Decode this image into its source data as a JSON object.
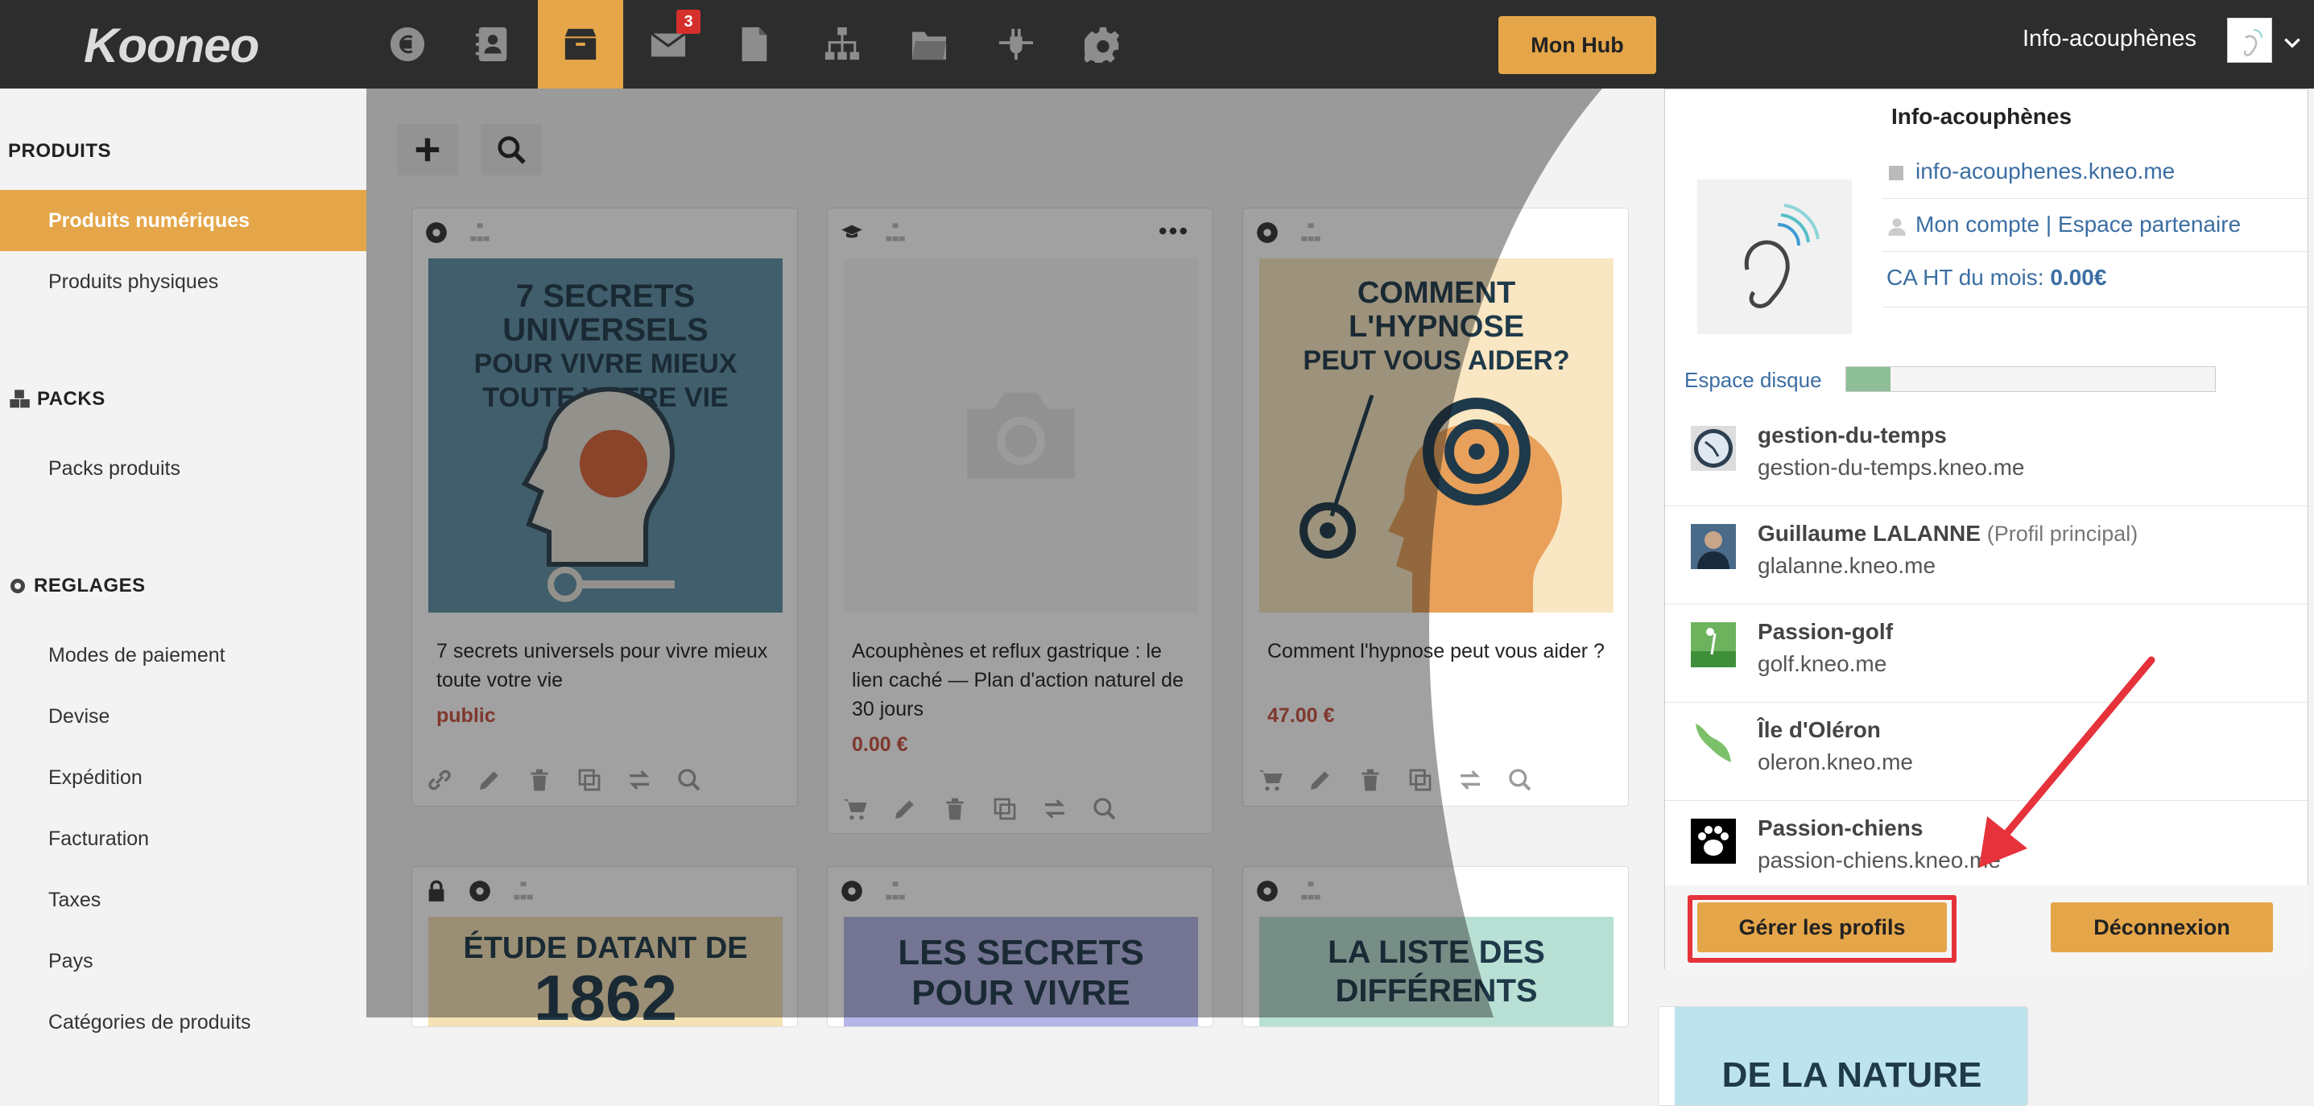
{
  "app": {
    "logo": "Kooneo",
    "username": "Info-acouphènes",
    "hub_label": "Mon Hub",
    "mail_count": "3"
  },
  "topnav": [
    {
      "icon": "euro-icon"
    },
    {
      "icon": "contacts-icon"
    },
    {
      "icon": "box-icon",
      "active": true
    },
    {
      "icon": "mail-icon"
    },
    {
      "icon": "document-icon"
    },
    {
      "icon": "sitemap-icon"
    },
    {
      "icon": "folder-icon"
    },
    {
      "icon": "plug-icon"
    },
    {
      "icon": "gear-icon"
    }
  ],
  "sidebar": {
    "sections": [
      {
        "title": "PRODUITS",
        "items": [
          "Produits numériques",
          "Produits physiques"
        ]
      },
      {
        "title": "PACKS",
        "items": [
          "Packs produits"
        ]
      },
      {
        "title": "REGLAGES",
        "items": [
          "Modes de paiement",
          "Devise",
          "Expédition",
          "Facturation",
          "Taxes",
          "Pays",
          "Catégories de produits"
        ]
      }
    ]
  },
  "products": [
    {
      "title": "7 secrets universels pour vivre mieux toute votre vie",
      "price": "public",
      "cover": [
        "7 SECRETS",
        "UNIVERSELS",
        "POUR VIVRE MIEUX",
        "TOUTE VOTRE VIE"
      ]
    },
    {
      "title": "Acouphènes et reflux gastrique : le lien caché — Plan d'action naturel de 30 jours",
      "price": "0.00 €",
      "cover": []
    },
    {
      "title": "Comment l'hypnose peut vous aider ?",
      "price": "47.00 €",
      "cover": [
        "COMMENT",
        "L'HYPNOSE",
        "PEUT VOUS AIDER?"
      ]
    },
    {
      "cover": [
        "ÉTUDE DATANT DE",
        "1862"
      ]
    },
    {
      "cover": [
        "LES SECRETS",
        "POUR VIVRE"
      ]
    },
    {
      "cover": [
        "LA LISTE DES",
        "DIFFÉRENTS"
      ]
    },
    {
      "cover": [
        "DE LA NATURE"
      ]
    }
  ],
  "dropdown": {
    "title": "Info-acouphènes",
    "site_url": "info-acouphenes.kneo.me",
    "account": "Mon compte",
    "sep": "|",
    "partner": "Espace partenaire",
    "ca_label": "CA HT du mois:",
    "ca_value": "0.00€",
    "disk_label": "Espace disque",
    "disk_usage": 0.12,
    "profiles": [
      {
        "name": "gestion-du-temps",
        "note": "",
        "url": "gestion-du-temps.kneo.me",
        "icon": "clock-icon"
      },
      {
        "name": "Guillaume LALANNE",
        "note": "(Profil principal)",
        "url": "glalanne.kneo.me",
        "icon": "portrait-icon"
      },
      {
        "name": "Passion-golf",
        "note": "",
        "url": "golf.kneo.me",
        "icon": "golf-icon"
      },
      {
        "name": "Île d'Oléron",
        "note": "",
        "url": "oleron.kneo.me",
        "icon": "island-icon"
      },
      {
        "name": "Passion-chiens",
        "note": "",
        "url": "passion-chiens.kneo.me",
        "icon": "paw-icon"
      }
    ],
    "manage_label": "Gérer les profils",
    "logout_label": "Déconnexion"
  },
  "colors": {
    "accent": "#e5a649",
    "topbar": "#2d2d2d",
    "link": "#3b6ea3",
    "price": "#c7503f",
    "highlight": "#e5323b"
  }
}
